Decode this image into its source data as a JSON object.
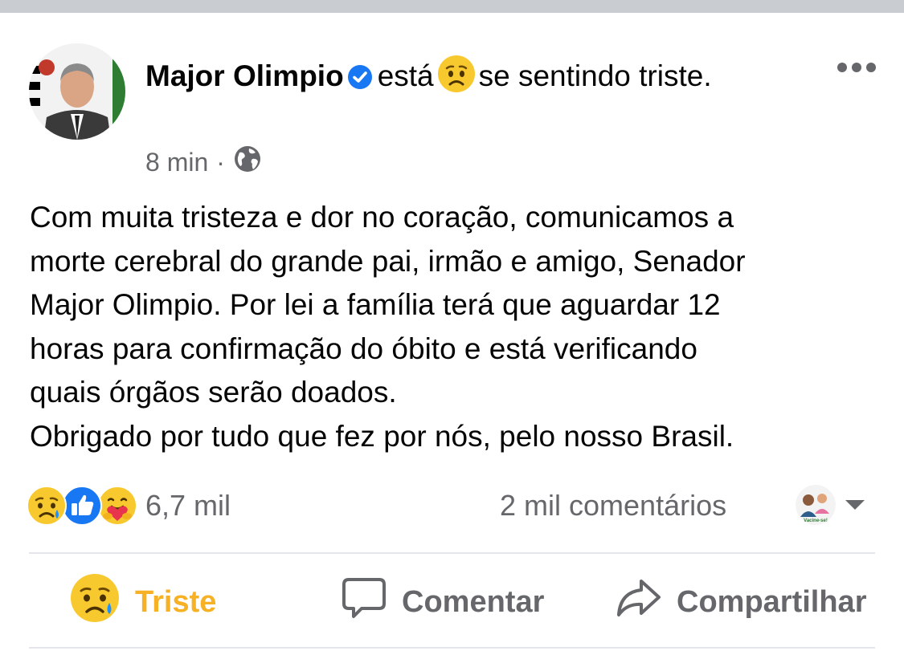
{
  "post": {
    "author": "Major Olimpio",
    "feeling_prefix": "está",
    "feeling_text": "se sentindo triste.",
    "time": "8 min",
    "privacy_icon": "globe-icon",
    "body_lines": [
      "Com muita tristeza e dor no coração, comunicamos a",
      "morte cerebral do grande pai, irmão e amigo, Senador",
      "Major Olimpio. Por lei a família terá que aguardar 12",
      "horas para confirmação do óbito e está verificando",
      "quais órgãos serão doados.",
      "Obrigado por tudo que fez por nós, pelo nosso Brasil."
    ]
  },
  "reactions": {
    "icons": [
      "sad-reaction-icon",
      "like-reaction-icon",
      "care-reaction-icon"
    ],
    "count": "6,7 mil",
    "comments": "2 mil comentários",
    "frame_caption": "Vacine-se!"
  },
  "actions": {
    "react_label": "Triste",
    "comment_label": "Comentar",
    "share_label": "Compartilhar"
  },
  "colors": {
    "verified": "#1877f2",
    "triste_accent": "#f7b125",
    "secondary_text": "#65676b",
    "divider": "#e4e6eb"
  }
}
